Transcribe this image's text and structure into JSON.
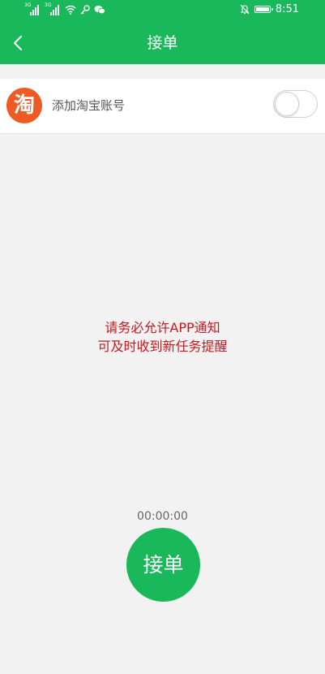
{
  "statusbar": {
    "sim1": "3G",
    "sim2": "3G",
    "time": "8:51",
    "icons": [
      "signal-icon",
      "signal-icon",
      "wifi-icon",
      "key-icon",
      "wechat-icon",
      "mute-bell-icon",
      "battery-icon"
    ]
  },
  "navbar": {
    "title": "接单",
    "back_icon": "chevron-left-icon"
  },
  "account": {
    "logo_char": "淘",
    "label": "添加淘宝账号",
    "toggle_on": false
  },
  "notice": {
    "line1": "请务必允许APP通知",
    "line2": "可及时收到新任务提醒"
  },
  "timer": "00:00:00",
  "accept_button": "接单",
  "colors": {
    "brand_green": "#19b85a",
    "notice_red": "#c9171e",
    "taobao_orange": "#ee5a24",
    "background": "#f2f2f2"
  }
}
